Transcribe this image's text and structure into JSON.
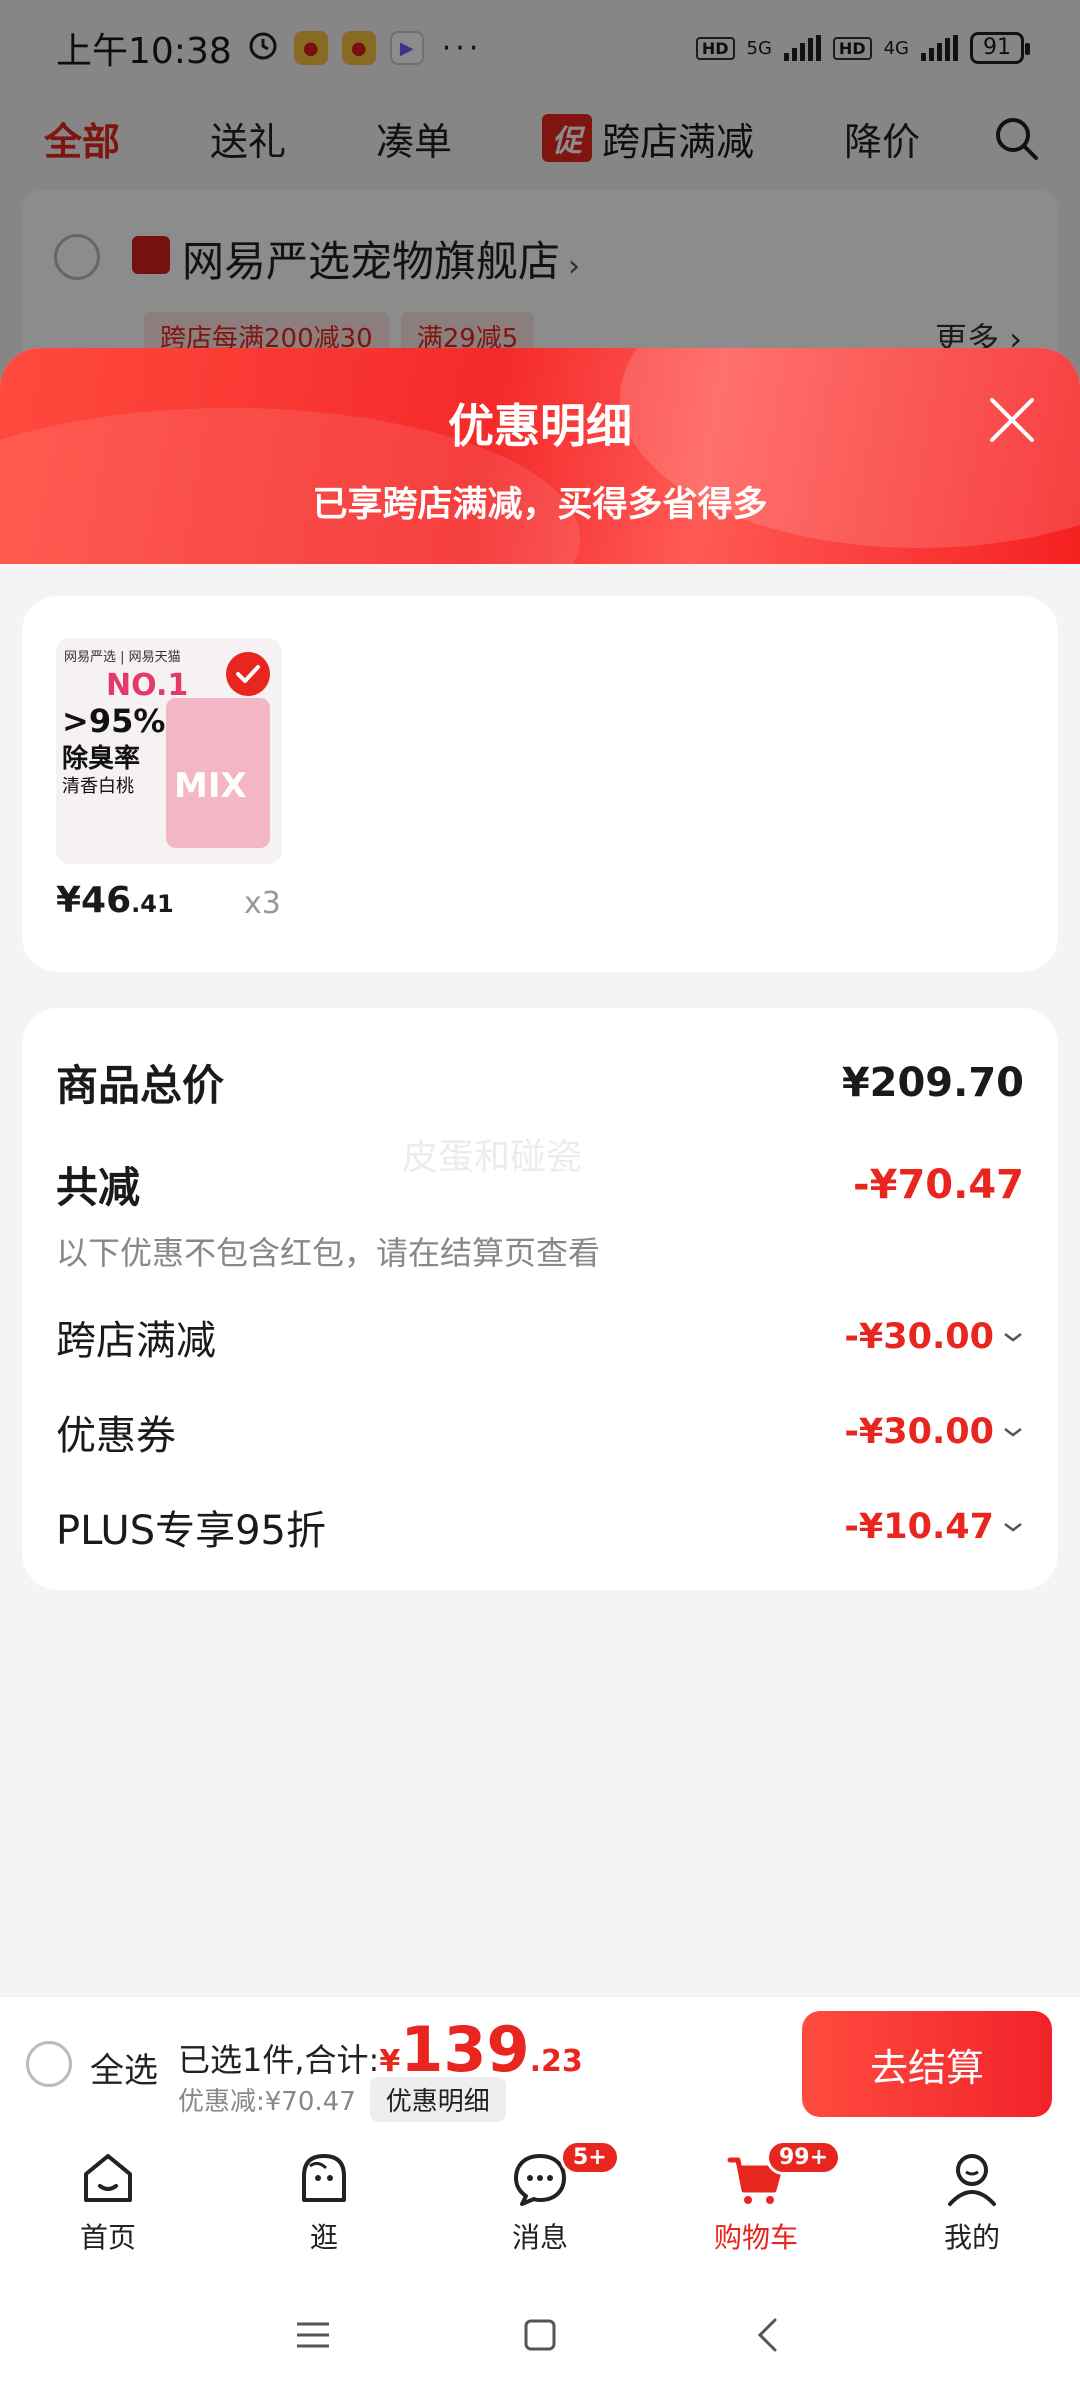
{
  "status_bar": {
    "time": "上午10:38",
    "battery": "91",
    "network": [
      "5G",
      "4G"
    ]
  },
  "tabs": [
    "全部",
    "送礼",
    "凑单",
    "跨店满减",
    "降价"
  ],
  "promo_badge": "促",
  "store": {
    "name": "网易严选宠物旗舰店",
    "tags": [
      "跨店每满200减30",
      "满29减5"
    ],
    "more": "更多"
  },
  "sheet": {
    "title": "优惠明细",
    "subtitle": "已享跨店满减，买得多省得多"
  },
  "product": {
    "image_texts": {
      "brand": "网易严选 | 网易天猫",
      "no1": "NO.1",
      "pct": ">95%",
      "line1": "除臭率",
      "line2": "清香白桃",
      "mix": "MIX"
    },
    "price_int": "¥46",
    "price_dec": ".41",
    "qty": "x3"
  },
  "summary": {
    "total_label": "商品总价",
    "total_value": "¥209.70",
    "reduce_label": "共减",
    "reduce_value": "-¥70.47",
    "note": "以下优惠不包含红包，请在结算页查看",
    "watermark": "皮蛋和碰瓷",
    "items": [
      {
        "label": "跨店满减",
        "value": "-¥30.00"
      },
      {
        "label": "优惠券",
        "value": "-¥30.00"
      },
      {
        "label": "PLUS专享95折",
        "value": "-¥10.47"
      }
    ]
  },
  "checkout": {
    "select_all": "全选",
    "selected_text": "已选1件,合计:",
    "currency": "¥",
    "total_int": "139",
    "total_dec": ".23",
    "discount_text": "优惠减:¥70.47",
    "detail_button": "优惠明细",
    "checkout_button": "去结算"
  },
  "tabbar": {
    "items": [
      {
        "label": "首页",
        "icon": "home-icon"
      },
      {
        "label": "逛",
        "icon": "explore-icon"
      },
      {
        "label": "消息",
        "icon": "message-icon",
        "badge": "5+"
      },
      {
        "label": "购物车",
        "icon": "cart-icon",
        "badge": "99+"
      },
      {
        "label": "我的",
        "icon": "profile-icon"
      }
    ]
  },
  "colors": {
    "accent": "#e8251e",
    "background": "#f4f4f4"
  }
}
